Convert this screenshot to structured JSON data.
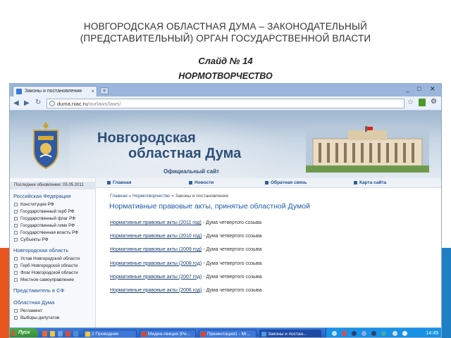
{
  "slide": {
    "title_line1": "НОВГОРОДСКАЯ ОБЛАСТНАЯ ДУМА – ЗАКОНОДАТЕЛЬНЫЙ",
    "title_line2": "(ПРЕДСТАВИТЕЛЬНЫЙ) ОРГАН ГОСУДАРСТВЕННОЙ ВЛАСТИ",
    "number": "Слайд № 14",
    "heading": "НОРМОТВОРЧЕСТВО"
  },
  "browser": {
    "tab_title": "Законы и постановления",
    "tab_close": "×",
    "new_tab": "+",
    "url_host": "duma.niac.ru",
    "url_path": "/ourlaws/laws/",
    "back": "◀",
    "forward": "▶",
    "reload": "↻",
    "star": "☆",
    "menu": "⚙"
  },
  "window": {
    "minimize": "_",
    "maximize": "□",
    "close": "✕"
  },
  "site": {
    "name_line1": "Новгородская",
    "name_line2": "областная Дума",
    "official": "Официальный сайт"
  },
  "sidebar": {
    "updated": "Последнее обновление: 05.05.2011",
    "sections": [
      {
        "title": "Российская Федерация",
        "items": [
          "Конституция РФ",
          "Государственный герб РФ",
          "Государственный флаг РФ",
          "Государственный гимн РФ",
          "Государственная власть РФ",
          "Субъекты РФ"
        ]
      },
      {
        "title": "Новгородская область",
        "items": [
          "Устав Новгородской области",
          "Герб Новгородской области",
          "Флаг Новгородской области",
          "Местное самоуправление"
        ]
      },
      {
        "title": "Представитель в СФ",
        "items": []
      },
      {
        "title": "Областная Дума",
        "items": [
          "Регламент",
          "Выборы депутатов"
        ]
      }
    ]
  },
  "menu": [
    "Главная",
    "Новости",
    "Обратная связь",
    "Карта сайта"
  ],
  "content": {
    "crumbs": [
      "Главная",
      "Нормотворчество",
      "Законы и постановления"
    ],
    "crumb_sep": " » ",
    "title": "Нормативные правовые акты, принятые областной Думой",
    "items": [
      {
        "link": "Нормативные правовые акты (2011 год)",
        "note": " - Дума четвертого созыва"
      },
      {
        "link": "Нормативные правовые акты (2010 год)",
        "note": " - Дума четвертого созыва"
      },
      {
        "link": "Нормативные правовые акты (2009 год)",
        "note": " - Дума четвертого созыва"
      },
      {
        "link": "Нормативные правовые акты (2008 год)",
        "note": " - Дума четвертого созыва"
      },
      {
        "link": "Нормативные правовые акты (2007 год)",
        "note": " - Дума четвертого созыва"
      },
      {
        "link": "Нормативные правовые акты (2006 год)",
        "note": " - Дума четвертого созыва"
      }
    ]
  },
  "taskbar": {
    "start": "Пуск",
    "tasks": [
      "2 Проводник",
      "Медиа-лекция [Ре...",
      "Презентация1 - Mi...",
      "Законы и постан..."
    ],
    "clock": "14:49"
  },
  "colors": {
    "accent_orange": "#e8561f",
    "accent_blue": "#1f7fc4",
    "site_blue": "#2e4f77"
  }
}
